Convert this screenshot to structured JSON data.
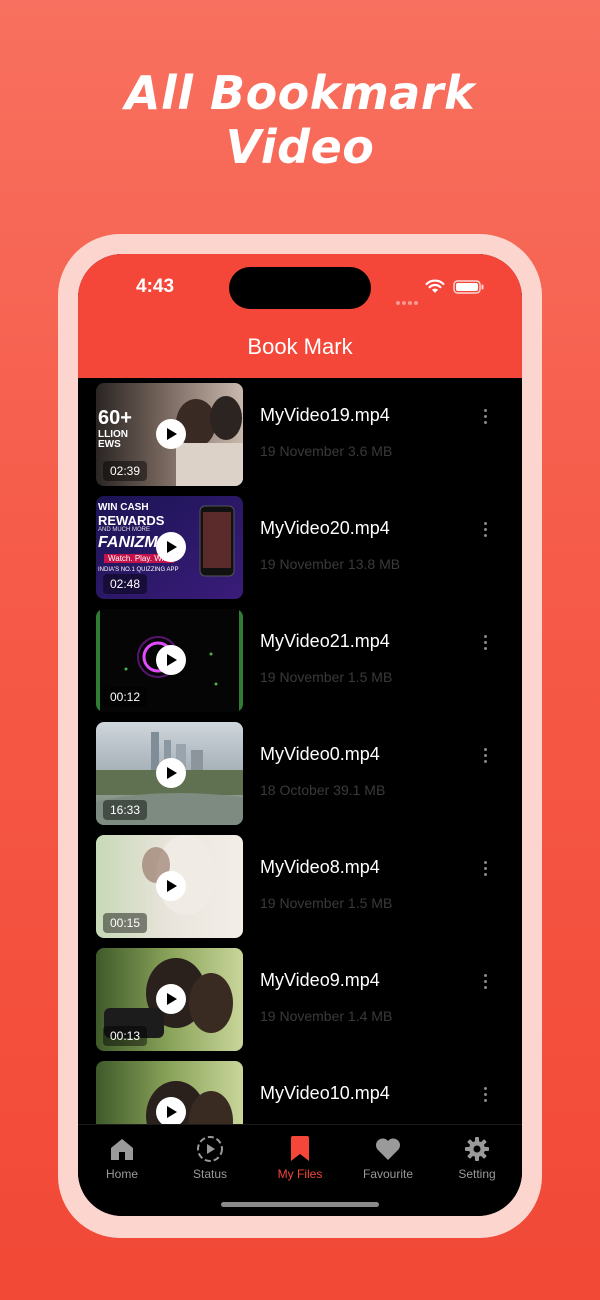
{
  "headline": {
    "line1": "All Bookmark",
    "line2": "Video"
  },
  "status_bar": {
    "time": "4:43"
  },
  "header": {
    "title": "Book Mark"
  },
  "videos": [
    {
      "name": "MyVideo19.mp4",
      "meta": "19 November 3.6 MB",
      "duration": "02:39"
    },
    {
      "name": "MyVideo20.mp4",
      "meta": "19 November 13.8 MB",
      "duration": "02:48"
    },
    {
      "name": "MyVideo21.mp4",
      "meta": "19 November 1.5 MB",
      "duration": "00:12"
    },
    {
      "name": "MyVideo0.mp4",
      "meta": "18 October 39.1 MB",
      "duration": "16:33"
    },
    {
      "name": "MyVideo8.mp4",
      "meta": "19 November 1.5 MB",
      "duration": "00:15"
    },
    {
      "name": "MyVideo9.mp4",
      "meta": "19 November 1.4 MB",
      "duration": "00:13"
    },
    {
      "name": "MyVideo10.mp4",
      "meta": "",
      "duration": ""
    }
  ],
  "thumb_text": {
    "v0": {
      "views_big": "60+",
      "views_sub": "LLION",
      "views_sub2": "EWS"
    },
    "v1": {
      "t1": "WIN CASH",
      "t2": "REWARDS",
      "t3": "AND MUCH MORE",
      "t4": "FANIZM",
      "t5": "Watch. Play. Win.",
      "t6": "INDIA'S NO.1 QUIZZING APP"
    }
  },
  "tabs": [
    {
      "label": "Home",
      "icon": "home-icon",
      "active": false
    },
    {
      "label": "Status",
      "icon": "status-play-icon",
      "active": false
    },
    {
      "label": "My Files",
      "icon": "bookmark-icon",
      "active": true
    },
    {
      "label": "Favourite",
      "icon": "heart-icon",
      "active": false
    },
    {
      "label": "Setting",
      "icon": "gear-icon",
      "active": false
    }
  ],
  "colors": {
    "accent": "#f5463a",
    "background_top": "#f8705f",
    "background_bottom": "#f24836",
    "frame": "#fcd5cf",
    "screen": "#000000",
    "meta_text": "#3a3a3a",
    "tab_inactive": "#9a9a9a"
  }
}
